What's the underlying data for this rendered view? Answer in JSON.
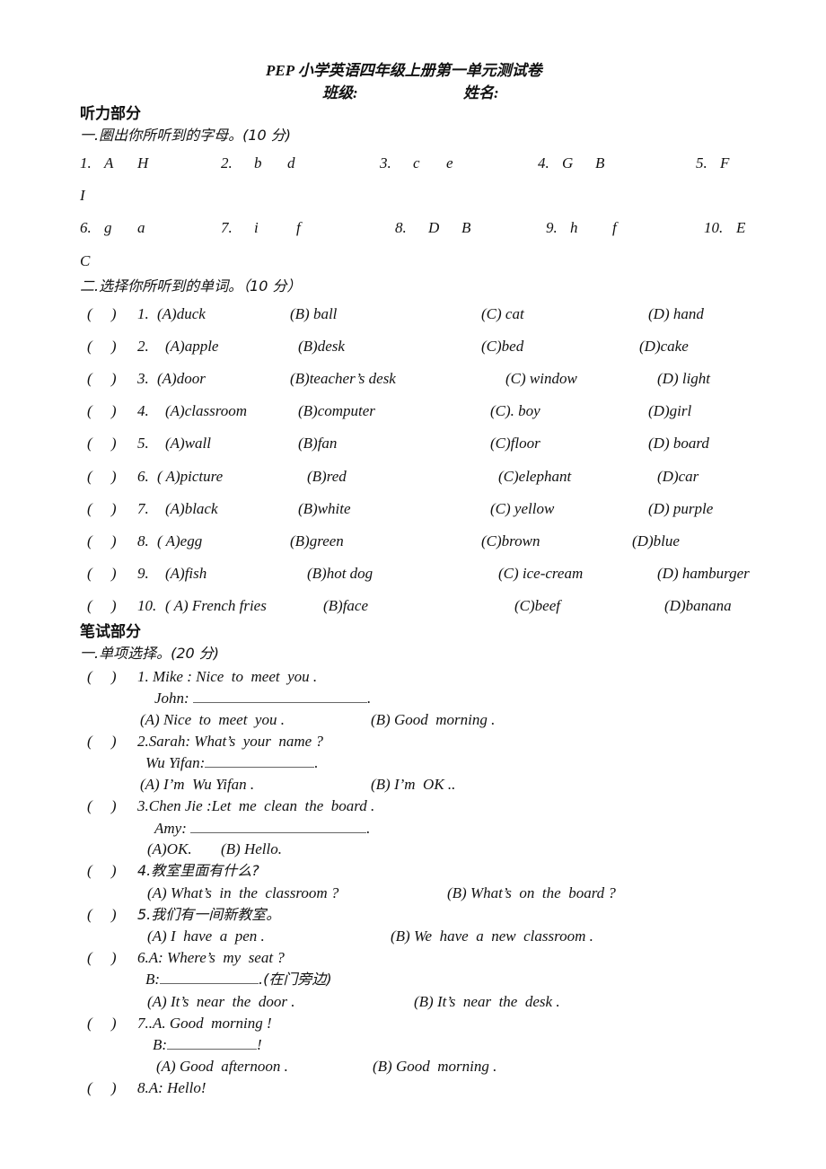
{
  "header": {
    "title": "PEP 小学英语四年级上册第一单元测试卷",
    "class_label": "班级:",
    "name_label": "姓名:"
  },
  "listening": {
    "heading": "听力部分",
    "part1": {
      "title": "一.圈出你所听到的字母。(10 分)",
      "items": [
        {
          "num": "1.",
          "a": "A",
          "b": "H"
        },
        {
          "num": "2.",
          "a": "b",
          "b": "d"
        },
        {
          "num": "3.",
          "a": "c",
          "b": "e"
        },
        {
          "num": "4.",
          "a": "G",
          "b": "B"
        },
        {
          "num": "5.",
          "a": "F",
          "b": "I"
        },
        {
          "num": "6.",
          "a": "g",
          "b": "a"
        },
        {
          "num": "7.",
          "a": "i",
          "b": "f"
        },
        {
          "num": "8.",
          "a": "D",
          "b": "B"
        },
        {
          "num": "9.",
          "a": "h",
          "b": "f"
        },
        {
          "num": "10.",
          "a": "E",
          "b": "C"
        }
      ]
    },
    "part2": {
      "title": "二.选择你所听到的单词。（10 分）",
      "bracket": "(     )",
      "items": [
        {
          "num": "1.",
          "A": "(A)duck",
          "B": "(B) ball",
          "C": "(C) cat",
          "D": "(D) hand"
        },
        {
          "num": "2.",
          "A": "(A)apple",
          "B": "(B)desk",
          "C": "(C)bed",
          "D": "(D)cake"
        },
        {
          "num": "3.",
          "A": "(A)door",
          "B": "(B)teacher’s desk",
          "C": "(C) window",
          "D": "(D) light"
        },
        {
          "num": "4.",
          "A": "(A)classroom",
          "B": "(B)computer",
          "C": "(C). boy",
          "D": "(D)girl"
        },
        {
          "num": "5.",
          "A": "(A)wall",
          "B": "(B)fan",
          "C": "(C)floor",
          "D": "(D) board"
        },
        {
          "num": "6.",
          "A": "( A)picture",
          "B": "(B)red",
          "C": "(C)elephant",
          "D": "(D)car"
        },
        {
          "num": "7.",
          "A": "(A)black",
          "B": "(B)white",
          "C": "(C) yellow",
          "D": "(D) purple"
        },
        {
          "num": "8.",
          "A": "( A)egg",
          "B": "(B)green",
          "C": "(C)brown",
          "D": "(D)blue"
        },
        {
          "num": "9.",
          "A": "(A)fish",
          "B": "(B)hot dog",
          "C": "(C) ice-cream",
          "D": "(D) hamburger"
        },
        {
          "num": "10.",
          "A": "( A) French fries",
          "B": "(B)face",
          "C": "(C)beef",
          "D": "(D)banana"
        }
      ]
    }
  },
  "writing": {
    "heading": "笔试部分",
    "part1": {
      "title": "一.单项选择。(20 分)",
      "bracket": "(     )",
      "items": [
        {
          "q": "1. Mike : Nice  to  meet  you .",
          "prompt": "John:",
          "tail": ".",
          "A": "(A) Nice  to  meet  you .",
          "B": "(B) Good  morning ."
        },
        {
          "q": "2.Sarah: What’s  your  name ?",
          "prompt": "Wu Yifan:",
          "tail": ".",
          "A": "(A) I’m  Wu Yifan .",
          "B": "(B) I’m  OK .."
        },
        {
          "q": "3.Chen Jie :Let  me  clean  the  board .",
          "prompt": "Amy:",
          "tail": ".",
          "A": "(A)OK.",
          "B": "(B) Hello."
        },
        {
          "q": "4.教室里面有什么?",
          "A": "(A) What’s  in  the  classroom ?",
          "B": "(B) What’s  on  the  board ?"
        },
        {
          "q": "5.我们有一间新教室。",
          "A": "(A) I  have  a  pen .",
          "B": "(B) We  have  a  new  classroom ."
        },
        {
          "q": "6.A: Where’s  my  seat ?",
          "prompt": "B:",
          "tail": ".(在门旁边)",
          "A": "(A) It’s  near  the  door .",
          "B": "(B) It’s  near  the  desk ."
        },
        {
          "q": "7..A. Good  morning !",
          "prompt": "B:",
          "tail": "!",
          "A": "(A) Good  afternoon .",
          "B": "(B) Good  morning ."
        },
        {
          "q": "8.A: Hello!"
        }
      ]
    }
  }
}
